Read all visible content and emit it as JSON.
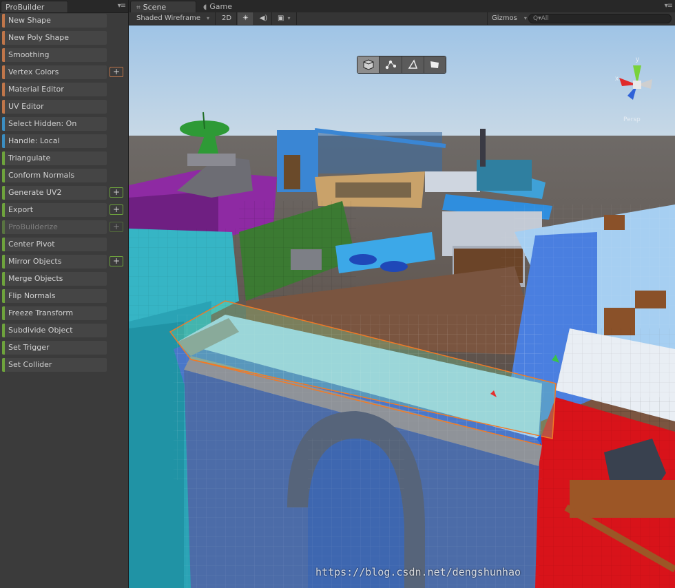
{
  "probuilder": {
    "tab_title": "ProBuilder",
    "items": [
      {
        "label": "New Shape",
        "color": "#c0764a",
        "plus": false,
        "disabled": false
      },
      {
        "label": "New Poly Shape",
        "color": "#c0764a",
        "plus": false,
        "disabled": false
      },
      {
        "label": "Smoothing",
        "color": "#c0764a",
        "plus": false,
        "disabled": false
      },
      {
        "label": "Vertex Colors",
        "color": "#c0764a",
        "plus": true,
        "disabled": false
      },
      {
        "label": "Material Editor",
        "color": "#c0764a",
        "plus": false,
        "disabled": false
      },
      {
        "label": "UV Editor",
        "color": "#c0764a",
        "plus": false,
        "disabled": false
      },
      {
        "label": "Select Hidden: On",
        "color": "#3b8ec2",
        "plus": false,
        "disabled": false
      },
      {
        "label": "Handle: Local",
        "color": "#3b8ec2",
        "plus": false,
        "disabled": false
      },
      {
        "label": "Triangulate",
        "color": "#6ea33d",
        "plus": false,
        "disabled": false
      },
      {
        "label": "Conform Normals",
        "color": "#6ea33d",
        "plus": false,
        "disabled": false
      },
      {
        "label": "Generate UV2",
        "color": "#6ea33d",
        "plus": true,
        "disabled": false
      },
      {
        "label": "Export",
        "color": "#6ea33d",
        "plus": true,
        "disabled": false
      },
      {
        "label": "ProBuilderize",
        "color": "#6ea33d",
        "plus": true,
        "disabled": true
      },
      {
        "label": "Center Pivot",
        "color": "#6ea33d",
        "plus": false,
        "disabled": false
      },
      {
        "label": "Mirror Objects",
        "color": "#6ea33d",
        "plus": true,
        "disabled": false
      },
      {
        "label": "Merge Objects",
        "color": "#6ea33d",
        "plus": false,
        "disabled": false
      },
      {
        "label": "Flip Normals",
        "color": "#6ea33d",
        "plus": false,
        "disabled": false
      },
      {
        "label": "Freeze Transform",
        "color": "#6ea33d",
        "plus": false,
        "disabled": false
      },
      {
        "label": "Subdivide Object",
        "color": "#6ea33d",
        "plus": false,
        "disabled": false
      },
      {
        "label": "Set Trigger",
        "color": "#6ea33d",
        "plus": false,
        "disabled": false
      },
      {
        "label": "Set Collider",
        "color": "#6ea33d",
        "plus": false,
        "disabled": false
      }
    ]
  },
  "tabs": {
    "scene": "Scene",
    "game": "Game"
  },
  "toolbar": {
    "shading_mode": "Shaded Wireframe",
    "two_d": "2D",
    "gizmos": "Gizmos",
    "search_placeholder": "All"
  },
  "scene": {
    "selection_modes": [
      {
        "icon": "object-cube-icon",
        "active": true
      },
      {
        "icon": "vertex-select-icon",
        "active": false
      },
      {
        "icon": "edge-select-icon",
        "active": false
      },
      {
        "icon": "face-select-icon",
        "active": false
      }
    ],
    "axis": {
      "y": "y",
      "x": "x"
    },
    "persp_label": "Persp"
  },
  "watermark": "https://blog.csdn.net/dengshunhao",
  "colors": {
    "plus_orange": "#c0764a",
    "plus_green": "#6ea33d",
    "accent_blue": "#3b8ec2"
  }
}
